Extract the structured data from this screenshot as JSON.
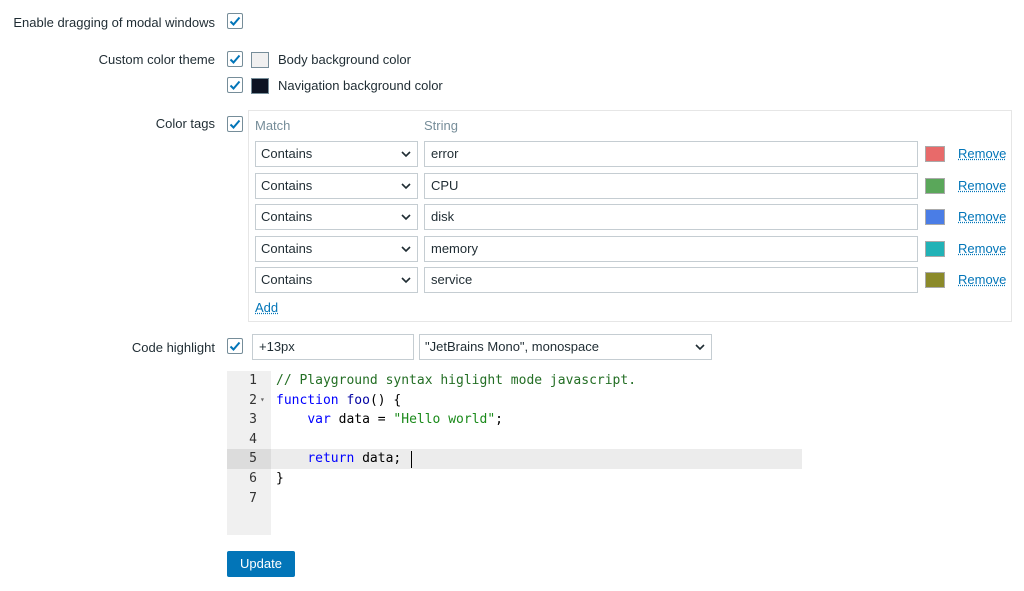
{
  "settings": {
    "drag_modal": {
      "label": "Enable dragging of modal windows",
      "checked": true
    },
    "custom_theme": {
      "label": "Custom color theme",
      "checked": true,
      "body_bg": {
        "label": "Body background color",
        "color": "#f0f0f0",
        "checked": true
      },
      "nav_bg": {
        "label": "Navigation background color",
        "color": "#0c1323",
        "checked": true
      }
    },
    "color_tags": {
      "label": "Color tags",
      "checked": true,
      "col_match": "Match",
      "col_string": "String",
      "remove_label": "Remove",
      "add_label": "Add",
      "rows": [
        {
          "match": "Contains",
          "string": "error",
          "color": "#e86a6a"
        },
        {
          "match": "Contains",
          "string": "CPU",
          "color": "#5aa75a"
        },
        {
          "match": "Contains",
          "string": "disk",
          "color": "#4a7de6"
        },
        {
          "match": "Contains",
          "string": "memory",
          "color": "#21b2b6"
        },
        {
          "match": "Contains",
          "string": "service",
          "color": "#8b8a2a"
        }
      ]
    },
    "code_highlight": {
      "label": "Code highlight",
      "checked": true,
      "font_size": "+13px",
      "font_family": "\"JetBrains Mono\", monospace"
    }
  },
  "editor": {
    "line_numbers": [
      "1",
      "2",
      "3",
      "4",
      "5",
      "6",
      "7"
    ],
    "active_line": 5,
    "lines": [
      "// Playground syntax higlight mode javascript.",
      "function foo() {",
      "    var data = \"Hello world\";",
      "",
      "    return data;",
      "}",
      ""
    ]
  },
  "update_button": "Update",
  "colors": {
    "accent": "#0275b8",
    "checkbox_border": "#768d99"
  }
}
